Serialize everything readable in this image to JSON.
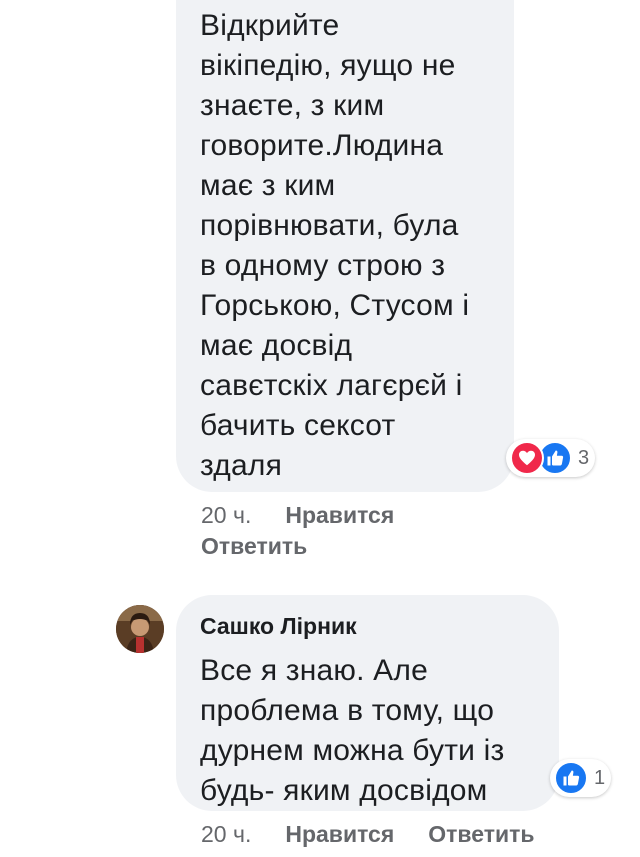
{
  "comment1": {
    "text": "Відкрийте\nвікіпедію, яущо не\nзнаєте, з ким\nговорите.Людина\nмає з ким\nпорівнювати, була\nв одному строю з\nГорською, Стусом і\nмає досвід\nсавєтскіх лагєрєй і\nбачить сексот\nздаля",
    "reaction_count": "3",
    "reaction_icons": [
      "heart-icon",
      "thumbs-up-icon"
    ],
    "time": "20 ч.",
    "like_label": "Нравится",
    "reply_label": "Ответить"
  },
  "comment2": {
    "author": "Сашко Лірник",
    "text": "Все я знаю. Але\nпроблема в тому, що\nдурнем можна бути із\nбудь- яким досвідом",
    "reaction_count": "1",
    "reaction_icons": [
      "thumbs-up-icon"
    ],
    "time": "20 ч.",
    "like_label": "Нравится",
    "reply_label": "Ответить"
  },
  "colors": {
    "bubble": "#f0f2f5",
    "text": "#1c1e21",
    "meta": "#65676b",
    "like_blue": "#1877f2",
    "love_red": "#f0284a"
  }
}
